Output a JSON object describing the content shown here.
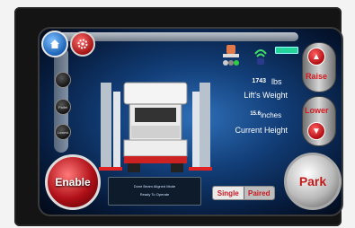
{
  "readouts": {
    "weight_value": "1743",
    "weight_unit": "lbs",
    "weight_label": "Lift's Weight",
    "height_value": "15.6",
    "height_unit": "inches",
    "height_label": "Current Height"
  },
  "controls": {
    "enable_label": "Enable",
    "park_label": "Park",
    "raise_label": "Raise",
    "lower_label": "Lower",
    "single_label": "Single",
    "paired_label": "Paired"
  },
  "status": {
    "line1": "Done Beam Aligned Mode",
    "line2": "Ready To Operate"
  },
  "side_buttons": [
    "",
    "Pallet",
    "Lowest"
  ],
  "colors": {
    "accent_red": "#c8181f",
    "screen_blue": "#123e78",
    "battery_green": "#23d39a"
  },
  "icons": [
    "home-icon",
    "gear-icon",
    "lift-status-icon",
    "wifi-icon",
    "battery-icon",
    "up-arrow-icon",
    "down-arrow-icon"
  ]
}
